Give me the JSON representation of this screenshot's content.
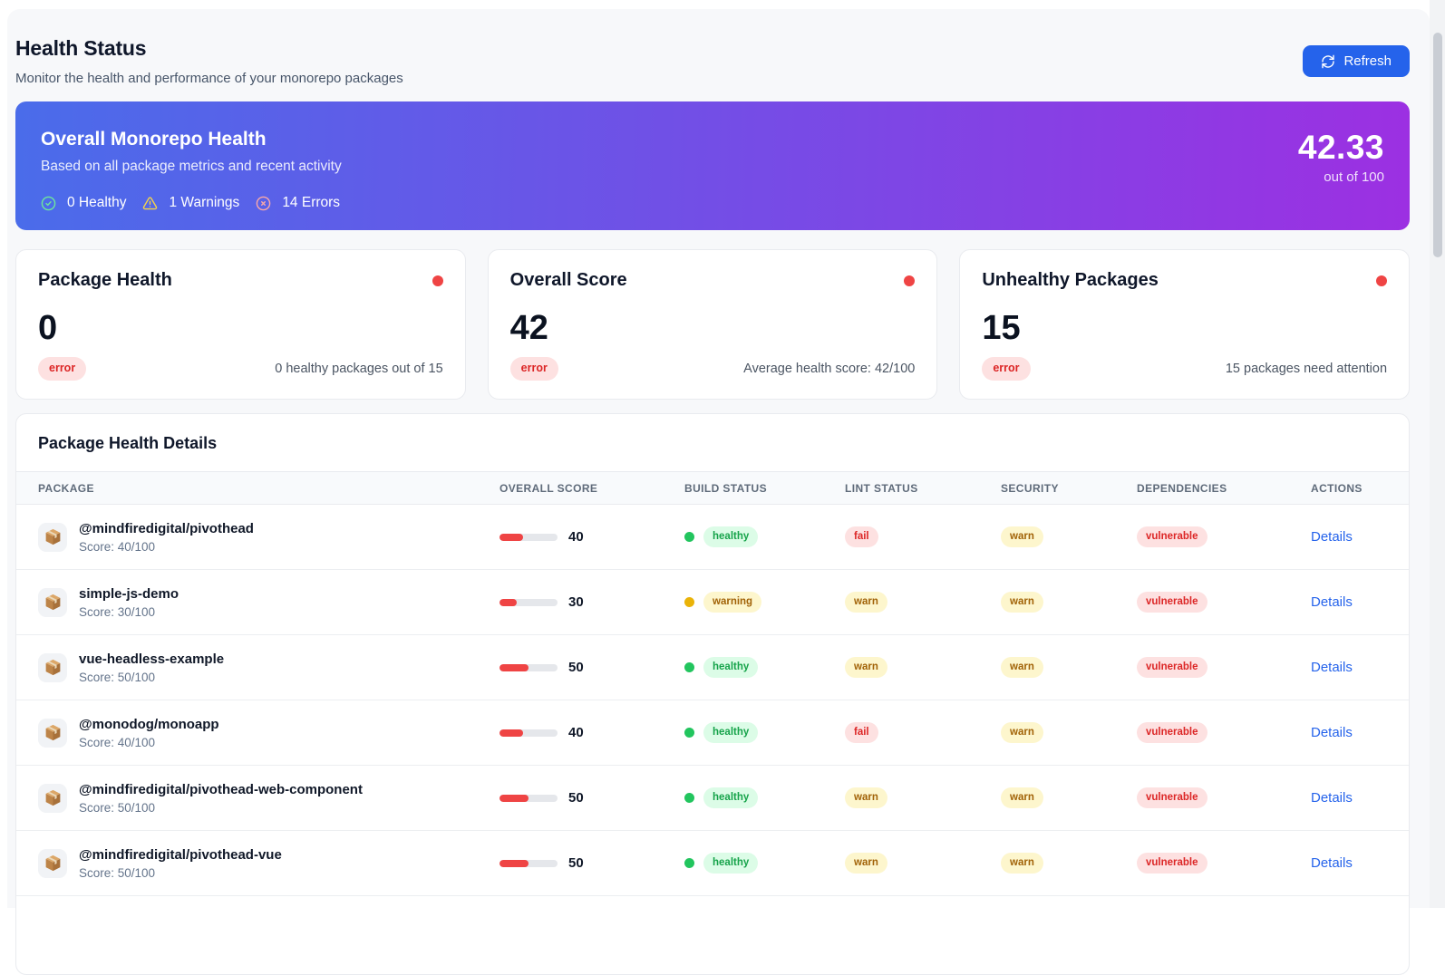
{
  "header": {
    "title": "Health Status",
    "subtitle": "Monitor the health and performance of your monorepo packages",
    "refresh_label": "Refresh"
  },
  "banner": {
    "title": "Overall Monorepo Health",
    "subtitle": "Based on all package metrics and recent activity",
    "stats": [
      {
        "icon": "check-circle-icon",
        "label": "0 Healthy"
      },
      {
        "icon": "warning-triangle-icon",
        "label": "1 Warnings"
      },
      {
        "icon": "x-circle-icon",
        "label": "14 Errors"
      }
    ],
    "score": "42.33",
    "score_caption": "out of 100",
    "gradient_from": "#4a6cea",
    "gradient_to": "#9c30e2"
  },
  "stat_cards": [
    {
      "title": "Package Health",
      "value": "0",
      "badge": "error",
      "note": "0 healthy packages out of 15"
    },
    {
      "title": "Overall Score",
      "value": "42",
      "badge": "error",
      "note": "Average health score: 42/100"
    },
    {
      "title": "Unhealthy Packages",
      "value": "15",
      "badge": "error",
      "note": "15 packages need attention"
    }
  ],
  "table": {
    "title": "Package Health Details",
    "columns": [
      "PACKAGE",
      "OVERALL SCORE",
      "BUILD STATUS",
      "LINT STATUS",
      "SECURITY",
      "DEPENDENCIES",
      "ACTIONS"
    ],
    "details_label": "Details",
    "rows": [
      {
        "name": "@mindfiredigital/pivothead",
        "score_label": "Score: 40/100",
        "score": 40,
        "build": "healthy",
        "lint": "fail",
        "security": "warn",
        "dependencies": "vulnerable"
      },
      {
        "name": "simple-js-demo",
        "score_label": "Score: 30/100",
        "score": 30,
        "build": "warning",
        "lint": "warn",
        "security": "warn",
        "dependencies": "vulnerable"
      },
      {
        "name": "vue-headless-example",
        "score_label": "Score: 50/100",
        "score": 50,
        "build": "healthy",
        "lint": "warn",
        "security": "warn",
        "dependencies": "vulnerable"
      },
      {
        "name": "@monodog/monoapp",
        "score_label": "Score: 40/100",
        "score": 40,
        "build": "healthy",
        "lint": "fail",
        "security": "warn",
        "dependencies": "vulnerable"
      },
      {
        "name": "@mindfiredigital/pivothead-web-component",
        "score_label": "Score: 50/100",
        "score": 50,
        "build": "healthy",
        "lint": "warn",
        "security": "warn",
        "dependencies": "vulnerable"
      },
      {
        "name": "@mindfiredigital/pivothead-vue",
        "score_label": "Score: 50/100",
        "score": 50,
        "build": "healthy",
        "lint": "warn",
        "security": "warn",
        "dependencies": "vulnerable"
      }
    ]
  },
  "colors": {
    "accent_blue": "#2563eb",
    "error_red": "#ef4444",
    "healthy_green": "#22c55e",
    "warning_yellow": "#f59e0b",
    "page_background": "#f7f8fa"
  }
}
